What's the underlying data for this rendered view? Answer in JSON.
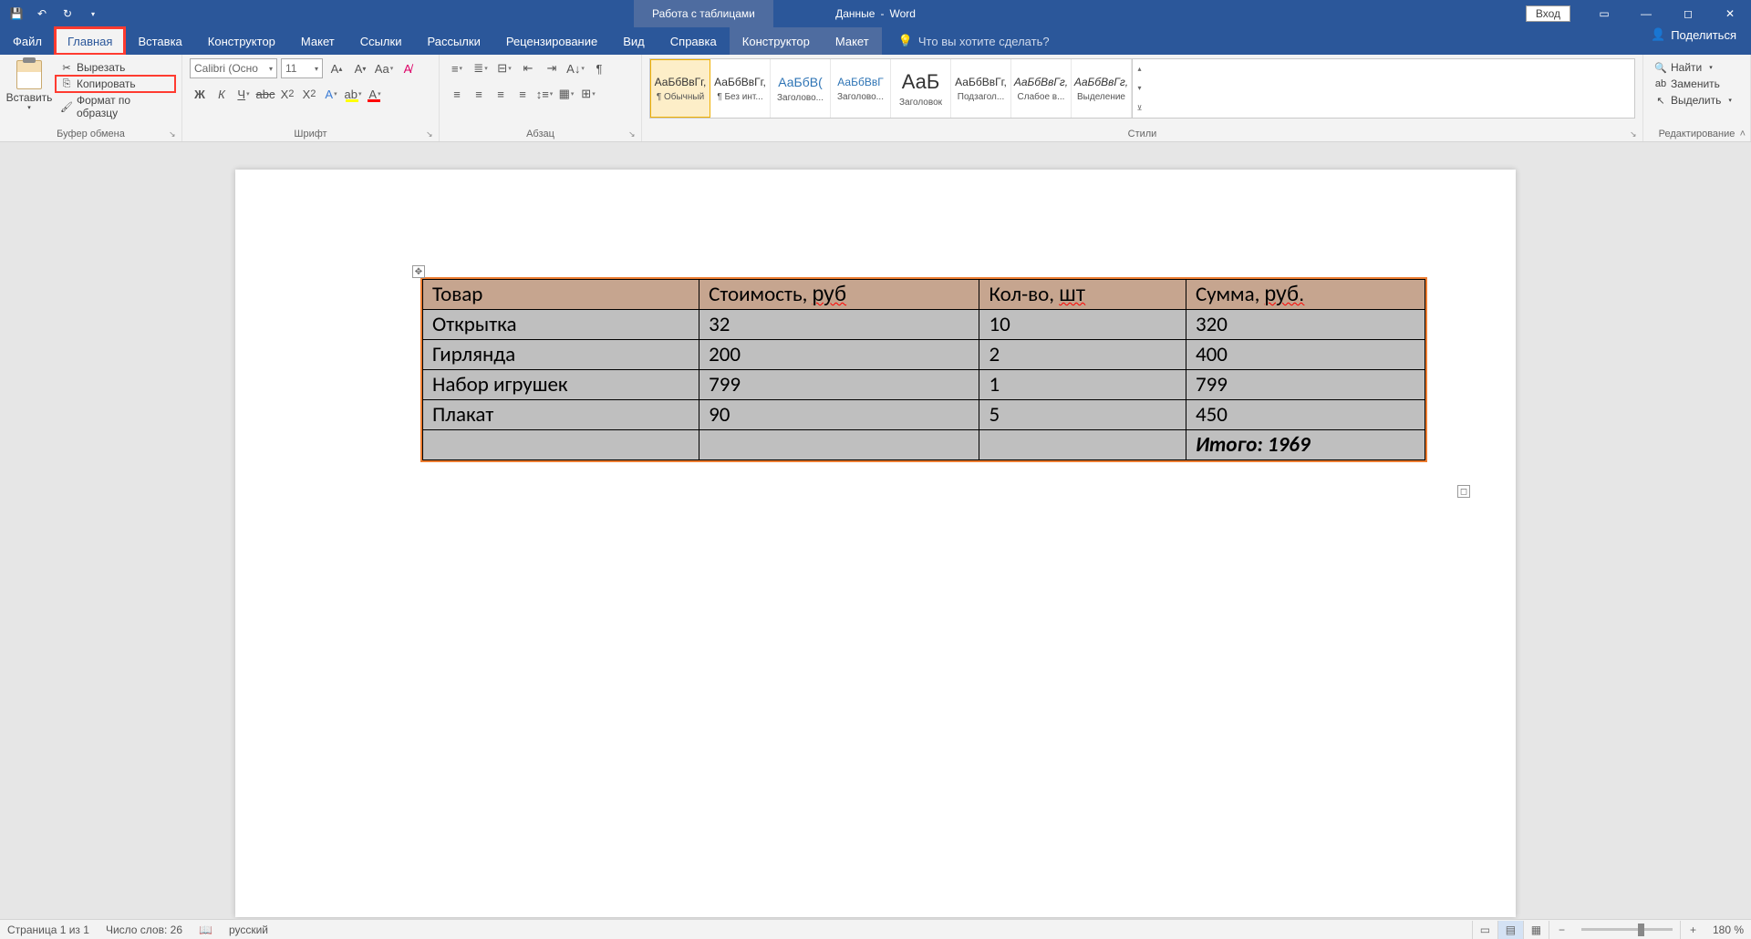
{
  "title": {
    "doc": "Данные",
    "app": "Word",
    "context_tab": "Работа с таблицами"
  },
  "titlebar": {
    "login": "Вход"
  },
  "tabs": {
    "file": "Файл",
    "home": "Главная",
    "insert": "Вставка",
    "design": "Конструктор",
    "layout": "Макет",
    "references": "Ссылки",
    "mailings": "Рассылки",
    "review": "Рецензирование",
    "view": "Вид",
    "help": "Справка",
    "tbl_design": "Конструктор",
    "tbl_layout": "Макет",
    "tell_me": "Что вы хотите сделать?",
    "share": "Поделиться"
  },
  "ribbon": {
    "clipboard": {
      "label": "Буфер обмена",
      "paste": "Вставить",
      "cut": "Вырезать",
      "copy": "Копировать",
      "format_painter": "Формат по образцу"
    },
    "font": {
      "label": "Шрифт",
      "name": "Calibri (Осно",
      "size": "11"
    },
    "paragraph": {
      "label": "Абзац"
    },
    "styles": {
      "label": "Стили",
      "items": [
        {
          "preview": "АаБбВвГг,",
          "name": "¶ Обычный"
        },
        {
          "preview": "АаБбВвГг,",
          "name": "¶ Без инт..."
        },
        {
          "preview": "АаБбВ(",
          "name": "Заголово..."
        },
        {
          "preview": "АаБбВвГ",
          "name": "Заголово..."
        },
        {
          "preview": "АаБ",
          "name": "Заголовок"
        },
        {
          "preview": "АаБбВвГг,",
          "name": "Подзагол..."
        },
        {
          "preview": "АаБбВвГг,",
          "name": "Слабое в..."
        },
        {
          "preview": "АаБбВвГг,",
          "name": "Выделение"
        }
      ]
    },
    "editing": {
      "label": "Редактирование",
      "find": "Найти",
      "replace": "Заменить",
      "select": "Выделить"
    }
  },
  "table": {
    "headers": [
      "Товар",
      "Стоимость, руб",
      "Кол-во, шт",
      "Сумма, руб."
    ],
    "rows": [
      [
        "Открытка",
        "32",
        "10",
        "320"
      ],
      [
        "Гирлянда",
        "200",
        "2",
        "400"
      ],
      [
        "Набор игрушек",
        "799",
        "1",
        "799"
      ],
      [
        "Плакат",
        "90",
        "5",
        "450"
      ]
    ],
    "total": "Итого: 1969"
  },
  "status": {
    "page": "Страница 1 из 1",
    "words": "Число слов: 26",
    "lang": "русский",
    "zoom": "180 %"
  }
}
